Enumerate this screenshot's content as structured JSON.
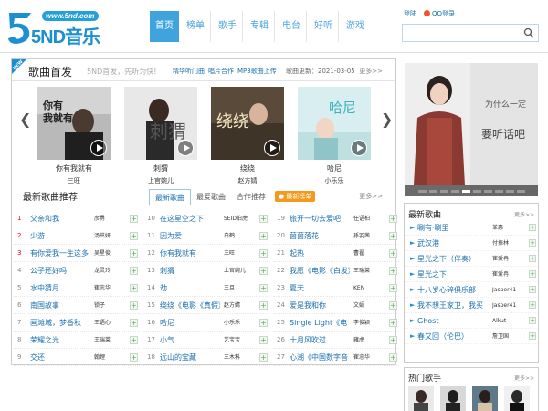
{
  "logo": {
    "url": "www.5nd.com",
    "text": "5ND音乐"
  },
  "nav": [
    {
      "label": "首页",
      "active": true
    },
    {
      "label": "榜单"
    },
    {
      "label": "歌手"
    },
    {
      "label": "专辑"
    },
    {
      "label": "电台"
    },
    {
      "label": "好听"
    },
    {
      "label": "游戏"
    }
  ],
  "login": {
    "login_label": "登陆",
    "qq_label": "QQ登录"
  },
  "search": {
    "placeholder": ""
  },
  "new_releases": {
    "badge": "NEW",
    "title": "歌曲首发",
    "subtitle": "5ND首发，先听为快!",
    "links": [
      "精华听门曲",
      "唱片合作",
      "MP3歌曲上传"
    ],
    "update": "歌曲更新：2021-03-05",
    "more": "更多>>",
    "albums": [
      {
        "title": "你有我就有",
        "artist": "三旺"
      },
      {
        "title": "刺猬",
        "artist": "上官婉儿"
      },
      {
        "title": "绕绕",
        "artist": "赵方婧"
      },
      {
        "title": "哈尼",
        "artist": "小乐乐"
      }
    ]
  },
  "recommend": {
    "title": "最新歌曲推荐",
    "tabs": [
      "最新歌曲",
      "最爱歌曲",
      "合作推荐"
    ],
    "badge": "● 最新榜单",
    "more": "更多>>",
    "col1": [
      {
        "num": "1",
        "name": "父亲和我",
        "artist": "彦勇"
      },
      {
        "num": "2",
        "name": "少游",
        "artist": "汤茁妍"
      },
      {
        "num": "3",
        "name": "有你爱我一生这多",
        "artist": "吴星俊"
      },
      {
        "num": "4",
        "name": "公子还好吗",
        "artist": "龙灵玲"
      },
      {
        "num": "5",
        "name": "水中猜月",
        "artist": "崔忠华"
      },
      {
        "num": "6",
        "name": "南国故事",
        "artist": "锁子"
      },
      {
        "num": "7",
        "name": "画滩城，梦香秋",
        "artist": "王语心"
      },
      {
        "num": "8",
        "name": "荣耀之光",
        "artist": "王瑞莱"
      },
      {
        "num": "9",
        "name": "交还",
        "artist": "翰娌"
      }
    ],
    "col2": [
      {
        "num": "10",
        "name": "在这星空之下",
        "artist": "SEID伯虎"
      },
      {
        "num": "11",
        "name": "因为爱",
        "artist": "白鹤"
      },
      {
        "num": "12",
        "name": "你有我就有",
        "artist": "三旺"
      },
      {
        "num": "13",
        "name": "刺猬",
        "artist": "上官婉儿"
      },
      {
        "num": "14",
        "name": "劫",
        "artist": "三旦"
      },
      {
        "num": "15",
        "name": "绕绕《电影《真假》",
        "artist": "赵方婧"
      },
      {
        "num": "16",
        "name": "哈尼",
        "artist": "小乐乐"
      },
      {
        "num": "17",
        "name": "小气",
        "artist": "艺宝宝"
      },
      {
        "num": "18",
        "name": "远山的宝藏",
        "artist": "三木科"
      }
    ],
    "col3": [
      {
        "num": "19",
        "name": "旅开一切去爱吧",
        "artist": "任语柏"
      },
      {
        "num": "20",
        "name": "菌菌落花",
        "artist": "孫羽茜"
      },
      {
        "num": "21",
        "name": "起热",
        "artist": "曹翟"
      },
      {
        "num": "22",
        "name": "我愿《电影《白发》",
        "artist": "王瑞莱"
      },
      {
        "num": "23",
        "name": "夏天",
        "artist": "KEN"
      },
      {
        "num": "24",
        "name": "爱是我和你",
        "artist": "文娟"
      },
      {
        "num": "25",
        "name": "Single Light《电",
        "artist": "李俊颖"
      },
      {
        "num": "26",
        "name": "十月风吹过",
        "artist": "雍虎"
      },
      {
        "num": "27",
        "name": "心潮《中国数字音",
        "artist": "崔忠华"
      }
    ]
  },
  "banner": {
    "dots": 10,
    "active_dot": 4
  },
  "latest": {
    "title": "最新歌曲",
    "more": "更多>>",
    "items": [
      {
        "name": "唰有·唰里",
        "artist": "革惠"
      },
      {
        "name": "武汉港",
        "artist": "付振林"
      },
      {
        "name": "星光之下（伴奏）",
        "artist": "崔爱冉"
      },
      {
        "name": "星光之下",
        "artist": "崔爱冉"
      },
      {
        "name": "十八岁心碎俱乐部",
        "artist": "Jasper41"
      },
      {
        "name": "我不想王家卫，我买",
        "artist": "Jasper41"
      },
      {
        "name": "Ghost",
        "artist": "Alkut"
      },
      {
        "name": "春又回（伦巴）",
        "artist": "詹卫国"
      }
    ]
  },
  "singers": {
    "title": "热门歌手",
    "more": "更多>>"
  },
  "colors": {
    "accent": "#3fa4de",
    "link": "#1a6fb0",
    "rank_red": "#e03",
    "badge_orange": "#f39a1c"
  }
}
